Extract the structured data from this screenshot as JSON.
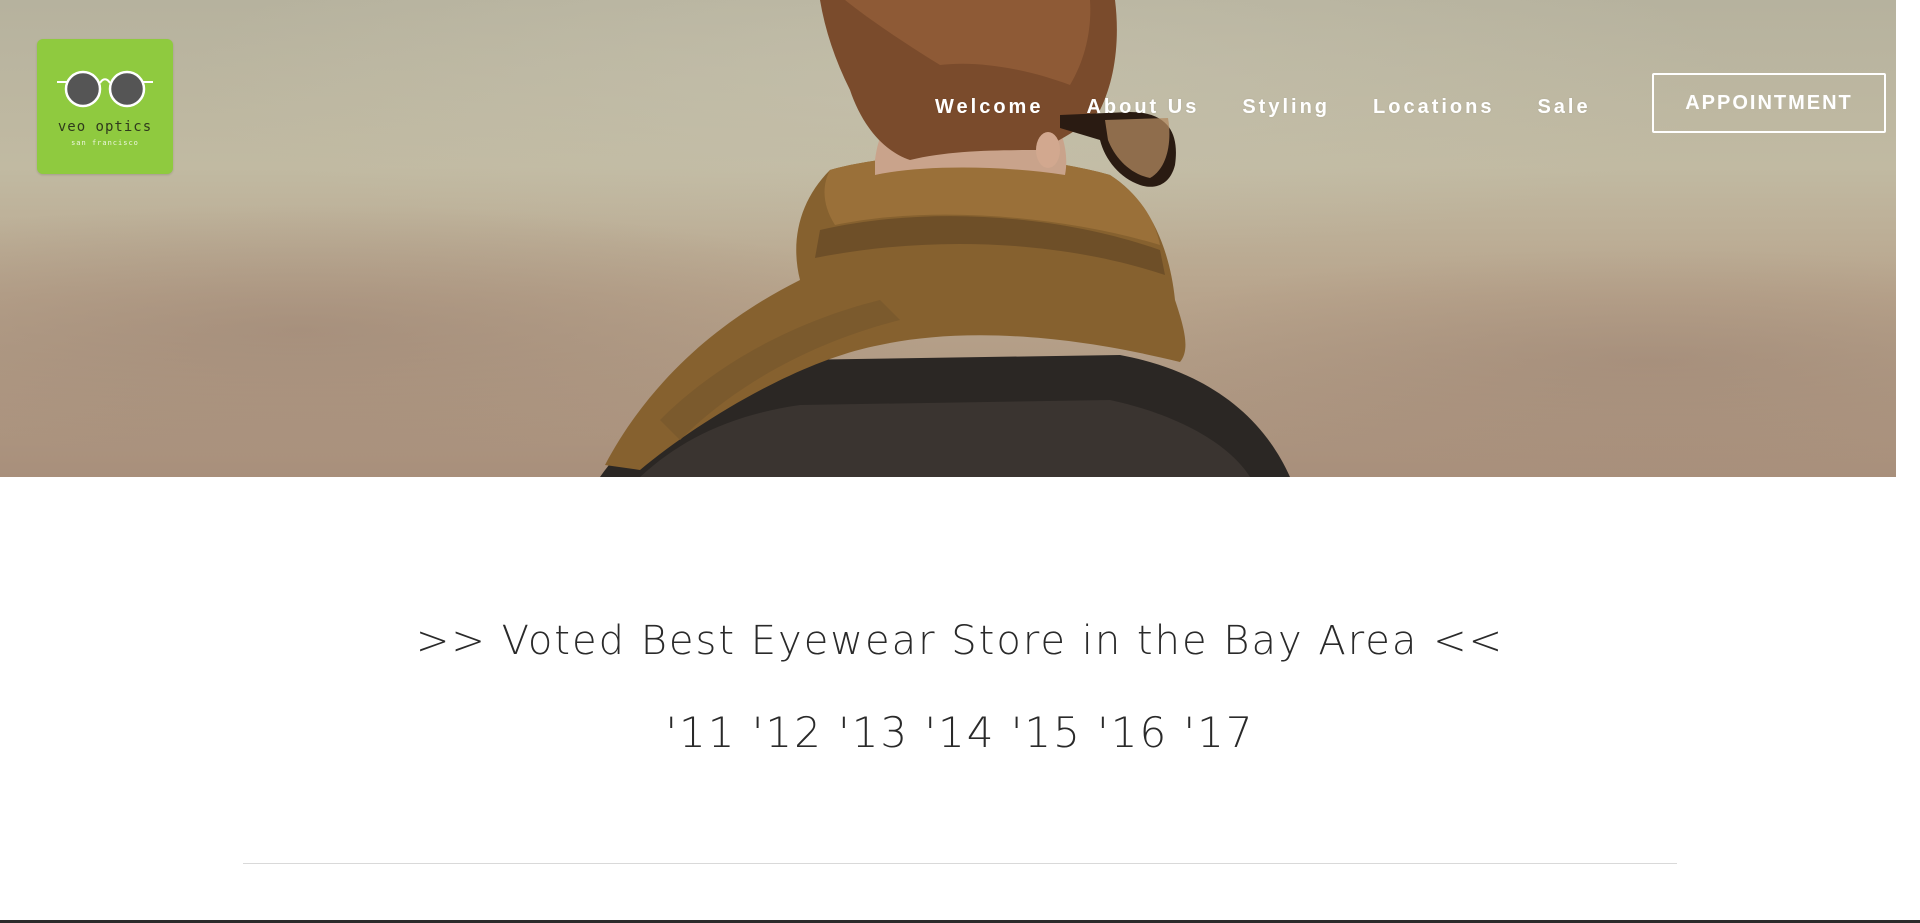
{
  "brand": {
    "name": "veo optics",
    "tagline": "san francisco",
    "logo_color": "#8fca3f",
    "logo_icon": "glasses-icon"
  },
  "nav": {
    "items": [
      {
        "label": "Welcome"
      },
      {
        "label": "About Us"
      },
      {
        "label": "Styling"
      },
      {
        "label": "Locations"
      },
      {
        "label": "Sale"
      }
    ],
    "cta_label": "APPOINTMENT"
  },
  "main": {
    "headline": ">>  Voted Best Eyewear Store in the Bay Area <<",
    "years": "'11 '12 '13 '14 '15 '16 '17"
  }
}
